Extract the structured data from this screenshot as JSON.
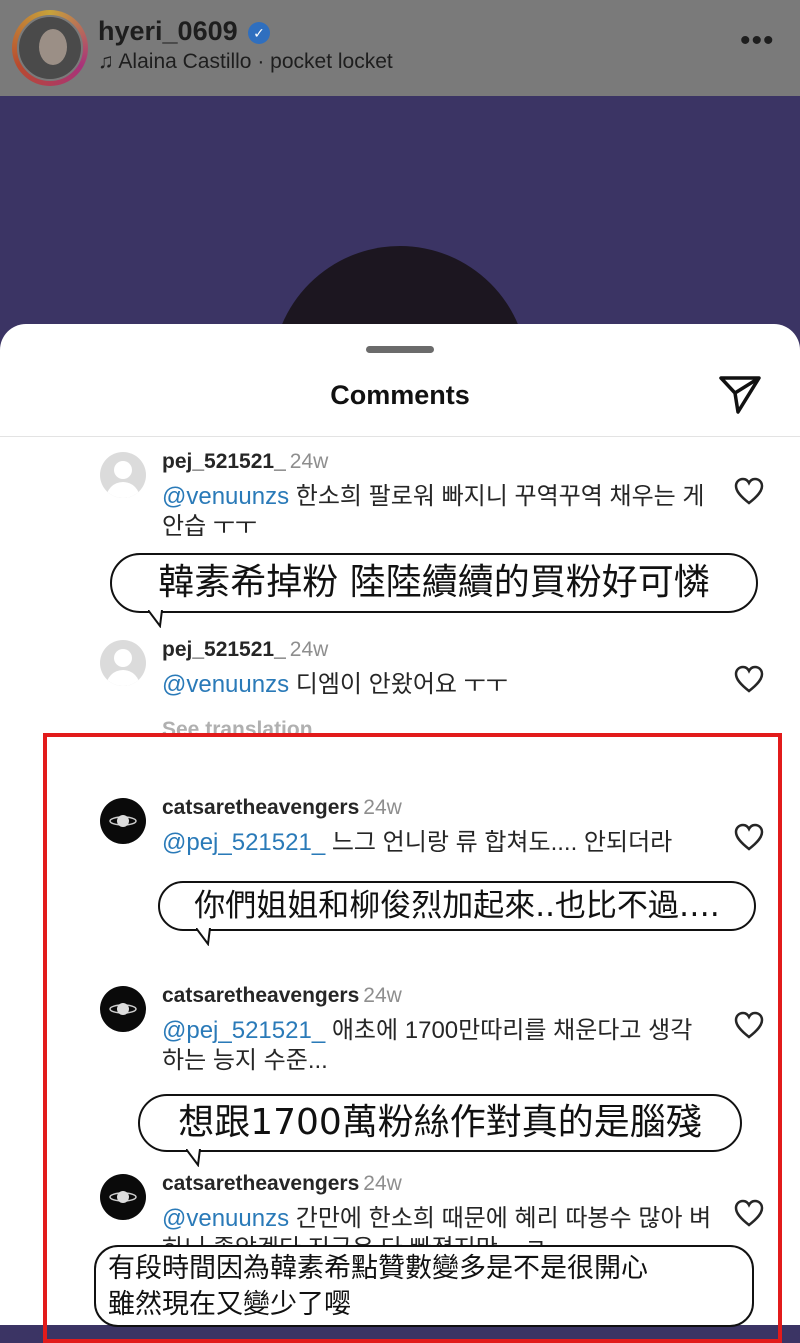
{
  "post_header": {
    "username": "hyeri_0609",
    "music": "♫ Alaina Castillo · pocket locket"
  },
  "sheet": {
    "title": "Comments"
  },
  "comments": [
    {
      "user": "pej_521521_",
      "time": "24w",
      "mention": "@venuunzs",
      "text": " 한소희 팔로워 빠지니 꾸역꾸역 채우는 게 안습 ㅜㅜ",
      "overlay": "韓素希掉粉 陸陸續續的買粉好可憐"
    },
    {
      "user": "pej_521521_",
      "time": "24w",
      "mention": "@venuunzs",
      "text": " 디엠이 안왔어요 ㅜㅜ",
      "see_translation": "See translation"
    },
    {
      "user": "catsaretheavengers",
      "time": "24w",
      "mention": "@pej_521521_",
      "text": " 느그 언니랑 류 합쳐도.... 안되더라",
      "overlay": "你們姐姐和柳俊烈加起來..也比不過…."
    },
    {
      "user": "catsaretheavengers",
      "time": "24w",
      "mention": "@pej_521521_",
      "text": " 애초에 1700만따리를 채운다고 생각하는 능지 수준...",
      "overlay": "想跟1700萬粉絲作對真的是腦殘"
    },
    {
      "user": "catsaretheavengers",
      "time": "24w",
      "mention": "@venuunzs",
      "text": " 간만에 한소희 때문에 혜리 따봉수 많아 벼하니 좋았겠다 지금은 다 빠졌지만 ...ㅋ",
      "overlay_line1": "有段時間因為韓素希點贊數變多是不是很開心",
      "overlay_line2": "雖然現在又變少了嘤"
    }
  ]
}
